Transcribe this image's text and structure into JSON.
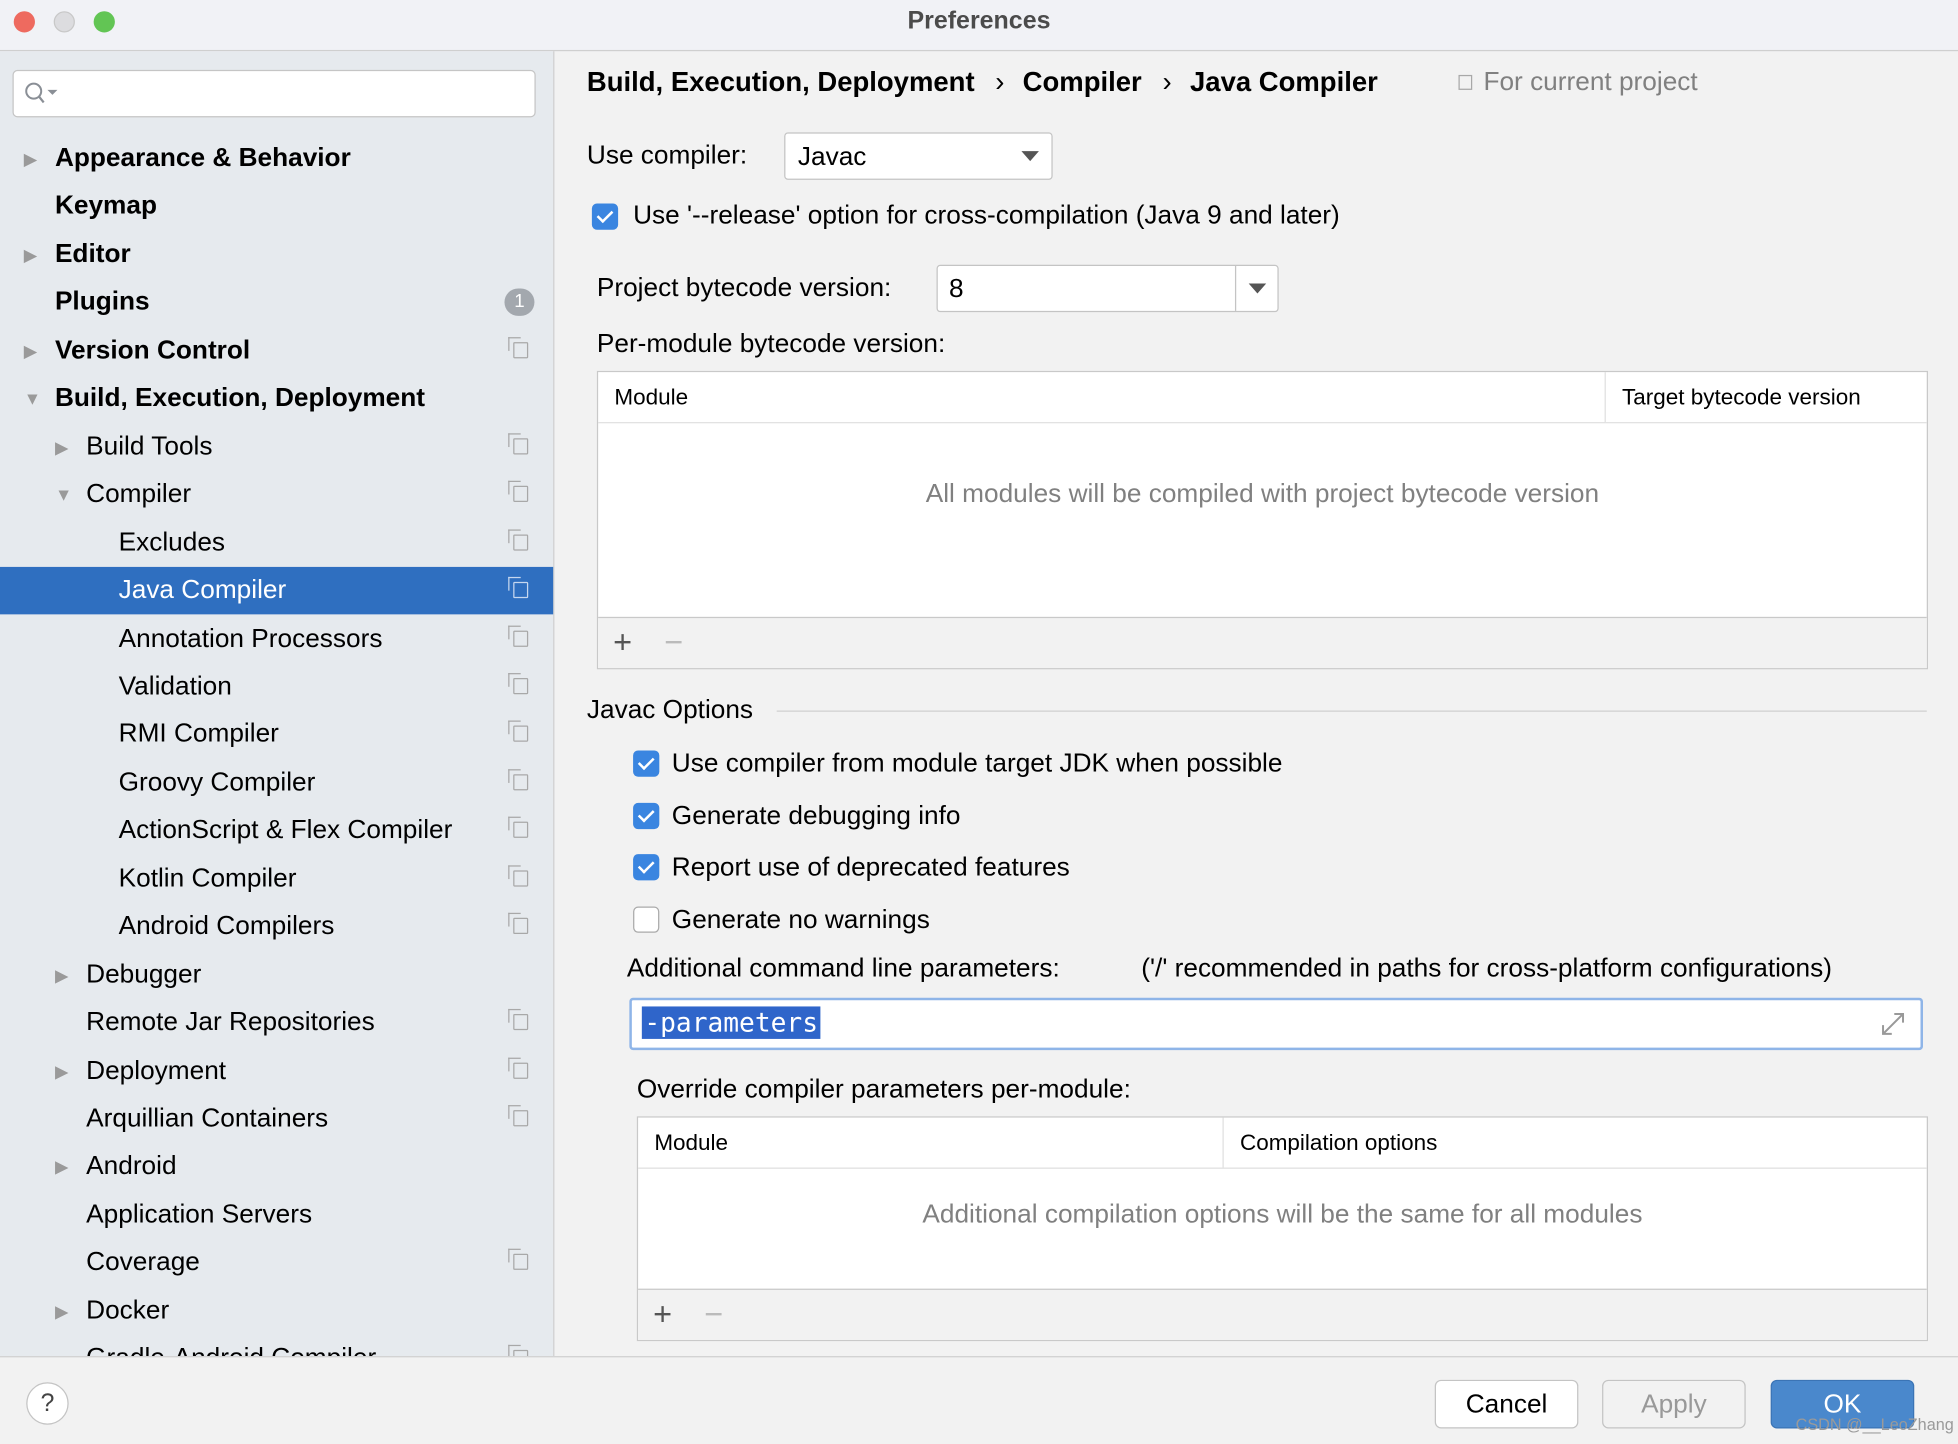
{
  "window": {
    "title": "Preferences"
  },
  "search": {
    "placeholder": ""
  },
  "sidebar": {
    "items": [
      {
        "label": "Appearance & Behavior",
        "level": 0,
        "arrow": "right",
        "bold": true
      },
      {
        "label": "Keymap",
        "level": 0,
        "bold": true
      },
      {
        "label": "Editor",
        "level": 0,
        "arrow": "right",
        "bold": true
      },
      {
        "label": "Plugins",
        "level": 0,
        "bold": true,
        "badge": "1"
      },
      {
        "label": "Version Control",
        "level": 0,
        "arrow": "right",
        "bold": true,
        "copy": true
      },
      {
        "label": "Build, Execution, Deployment",
        "level": 0,
        "arrow": "down",
        "bold": true
      },
      {
        "label": "Build Tools",
        "level": 1,
        "arrow": "right",
        "copy": true
      },
      {
        "label": "Compiler",
        "level": 1,
        "arrow": "down",
        "copy": true
      },
      {
        "label": "Excludes",
        "level": 2,
        "copy": true
      },
      {
        "label": "Java Compiler",
        "level": 2,
        "copy": true,
        "selected": true
      },
      {
        "label": "Annotation Processors",
        "level": 2,
        "copy": true
      },
      {
        "label": "Validation",
        "level": 2,
        "copy": true
      },
      {
        "label": "RMI Compiler",
        "level": 2,
        "copy": true
      },
      {
        "label": "Groovy Compiler",
        "level": 2,
        "copy": true
      },
      {
        "label": "ActionScript & Flex Compiler",
        "level": 2,
        "copy": true
      },
      {
        "label": "Kotlin Compiler",
        "level": 2,
        "copy": true
      },
      {
        "label": "Android Compilers",
        "level": 2,
        "copy": true
      },
      {
        "label": "Debugger",
        "level": 1,
        "arrow": "right"
      },
      {
        "label": "Remote Jar Repositories",
        "level": 1,
        "copy": true
      },
      {
        "label": "Deployment",
        "level": 1,
        "arrow": "right",
        "copy": true
      },
      {
        "label": "Arquillian Containers",
        "level": 1,
        "copy": true
      },
      {
        "label": "Android",
        "level": 1,
        "arrow": "right"
      },
      {
        "label": "Application Servers",
        "level": 1
      },
      {
        "label": "Coverage",
        "level": 1,
        "copy": true
      },
      {
        "label": "Docker",
        "level": 1,
        "arrow": "right"
      },
      {
        "label": "Gradle-Android Compiler",
        "level": 1,
        "copy": true
      }
    ]
  },
  "breadcrumb": {
    "items": [
      "Build, Execution, Deployment",
      "Compiler",
      "Java Compiler"
    ],
    "separator": "›",
    "scope": "For current project"
  },
  "main": {
    "use_compiler_label": "Use compiler:",
    "use_compiler_value": "Javac",
    "release_option": {
      "label": "Use '--release' option for cross-compilation (Java 9 and later)",
      "checked": true
    },
    "bytecode_label": "Project bytecode version:",
    "bytecode_value": "8",
    "per_module_label": "Per-module bytecode version:",
    "per_module_table": {
      "columns": [
        "Module",
        "Target bytecode version"
      ],
      "empty_text": "All modules will be compiled with project bytecode version"
    },
    "javac_section": "Javac Options",
    "javac_options": [
      {
        "label": "Use compiler from module target JDK when possible",
        "checked": true
      },
      {
        "label": "Generate debugging info",
        "checked": true
      },
      {
        "label": "Report use of deprecated features",
        "checked": true
      },
      {
        "label": "Generate no warnings",
        "checked": false
      }
    ],
    "cmd_label": "Additional command line parameters:",
    "cmd_hint": "('/' recommended in paths for cross-platform configurations)",
    "cmd_value": "-parameters",
    "override_label": "Override compiler parameters per-module:",
    "override_table": {
      "columns": [
        "Module",
        "Compilation options"
      ],
      "empty_text": "Additional compilation options will be the same for all modules"
    },
    "add": "+",
    "remove": "−"
  },
  "footer": {
    "help": "?",
    "cancel": "Cancel",
    "apply": "Apply",
    "ok": "OK",
    "watermark": "CSDN @__LeoZhang"
  },
  "colors": {
    "accent": "#2f6fc0",
    "checkbox": "#3a85e0",
    "ok": "#4a88cc"
  }
}
